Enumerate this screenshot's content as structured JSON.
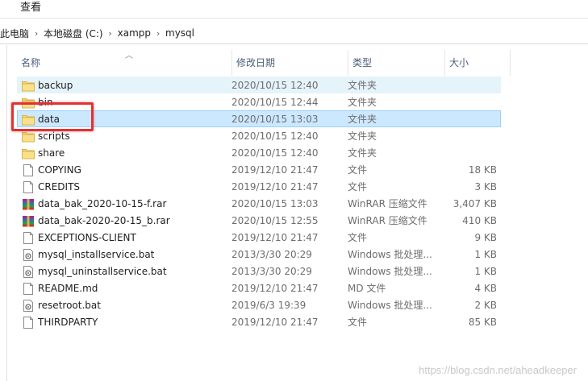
{
  "menu": {
    "view_label": "查看"
  },
  "address": {
    "crumbs": [
      "此电脑",
      "本地磁盘 (C:)",
      "xampp",
      "mysql"
    ]
  },
  "columns": {
    "name": "名称",
    "date": "修改日期",
    "type": "类型",
    "size": "大小"
  },
  "files": [
    {
      "name": "backup",
      "date": "2020/10/15 12:40",
      "type": "文件夹",
      "size": "",
      "icon": "folder-icon"
    },
    {
      "name": "bin",
      "date": "2020/10/15 12:44",
      "type": "文件夹",
      "size": "",
      "icon": "folder-icon"
    },
    {
      "name": "data",
      "date": "2020/10/15 13:03",
      "type": "文件夹",
      "size": "",
      "icon": "folder-icon"
    },
    {
      "name": "scripts",
      "date": "2020/10/15 12:40",
      "type": "文件夹",
      "size": "",
      "icon": "folder-icon"
    },
    {
      "name": "share",
      "date": "2020/10/15 12:40",
      "type": "文件夹",
      "size": "",
      "icon": "folder-icon"
    },
    {
      "name": "COPYING",
      "date": "2019/12/10 21:47",
      "type": "文件",
      "size": "18 KB",
      "icon": "file-icon"
    },
    {
      "name": "CREDITS",
      "date": "2019/12/10 21:47",
      "type": "文件",
      "size": "3 KB",
      "icon": "file-icon"
    },
    {
      "name": "data_bak_2020-10-15-f.rar",
      "date": "2020/10/15 13:03",
      "type": "WinRAR 压缩文件",
      "size": "3,407 KB",
      "icon": "rar-archive-icon"
    },
    {
      "name": "data_bak-2020-20-15_b.rar",
      "date": "2020/10/15 12:55",
      "type": "WinRAR 压缩文件",
      "size": "410 KB",
      "icon": "rar-archive-icon"
    },
    {
      "name": "EXCEPTIONS-CLIENT",
      "date": "2019/12/10 21:47",
      "type": "文件",
      "size": "9 KB",
      "icon": "file-icon"
    },
    {
      "name": "mysql_installservice.bat",
      "date": "2013/3/30 20:29",
      "type": "Windows 批处理...",
      "size": "1 KB",
      "icon": "batch-file-icon"
    },
    {
      "name": "mysql_uninstallservice.bat",
      "date": "2013/3/30 20:29",
      "type": "Windows 批处理...",
      "size": "1 KB",
      "icon": "batch-file-icon"
    },
    {
      "name": "README.md",
      "date": "2019/12/10 21:47",
      "type": "MD 文件",
      "size": "4 KB",
      "icon": "file-icon"
    },
    {
      "name": "resetroot.bat",
      "date": "2019/6/3 19:39",
      "type": "Windows 批处理...",
      "size": "2 KB",
      "icon": "batch-file-icon"
    },
    {
      "name": "THIRDPARTY",
      "date": "2019/12/10 21:47",
      "type": "文件",
      "size": "85 KB",
      "icon": "file-icon"
    }
  ],
  "selected_index": 2,
  "hover_index": 0,
  "watermark": "https://blog.csdn.net/aheadkeeper",
  "colors": {
    "folder": "#f8d775",
    "selection": "#cce8ff",
    "highlight": "#e53030"
  }
}
